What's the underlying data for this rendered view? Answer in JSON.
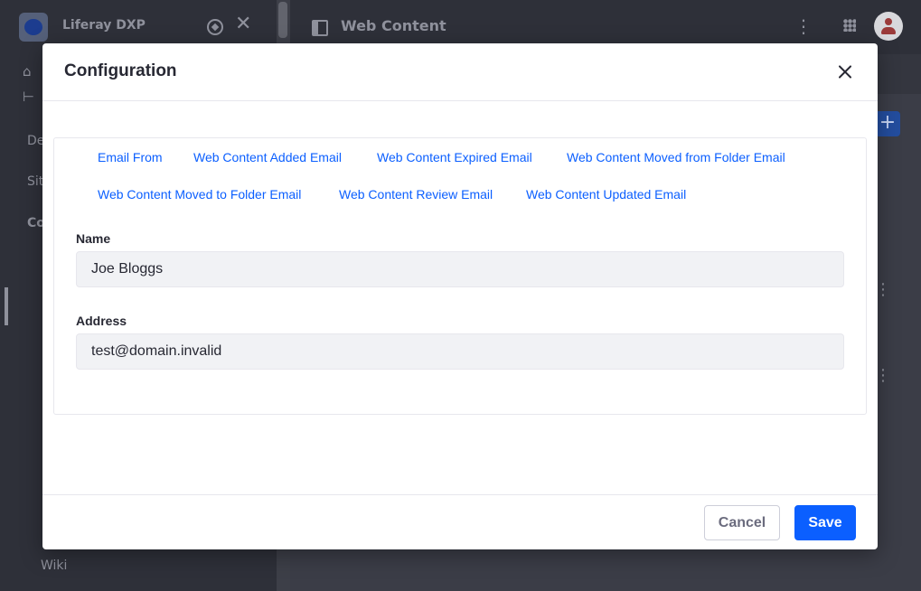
{
  "app": {
    "product_name": "Liferay DXP",
    "page_title": "Web Content",
    "sidebar_truncated": [
      "De",
      "Sit",
      "Co"
    ],
    "sidebar_bottom": "Wiki"
  },
  "modal": {
    "title": "Configuration",
    "tabs": [
      "Email From",
      "Web Content Added Email",
      "Web Content Expired Email",
      "Web Content Moved from Folder Email",
      "Web Content Moved to Folder Email",
      "Web Content Review Email",
      "Web Content Updated Email"
    ],
    "fields": {
      "name_label": "Name",
      "name_value": "Joe Bloggs",
      "address_label": "Address",
      "address_value": "test@domain.invalid"
    },
    "footer": {
      "cancel_label": "Cancel",
      "save_label": "Save"
    }
  },
  "colors": {
    "primary": "#0b5fff",
    "text": "#272833",
    "input_bg": "#f1f2f5"
  }
}
